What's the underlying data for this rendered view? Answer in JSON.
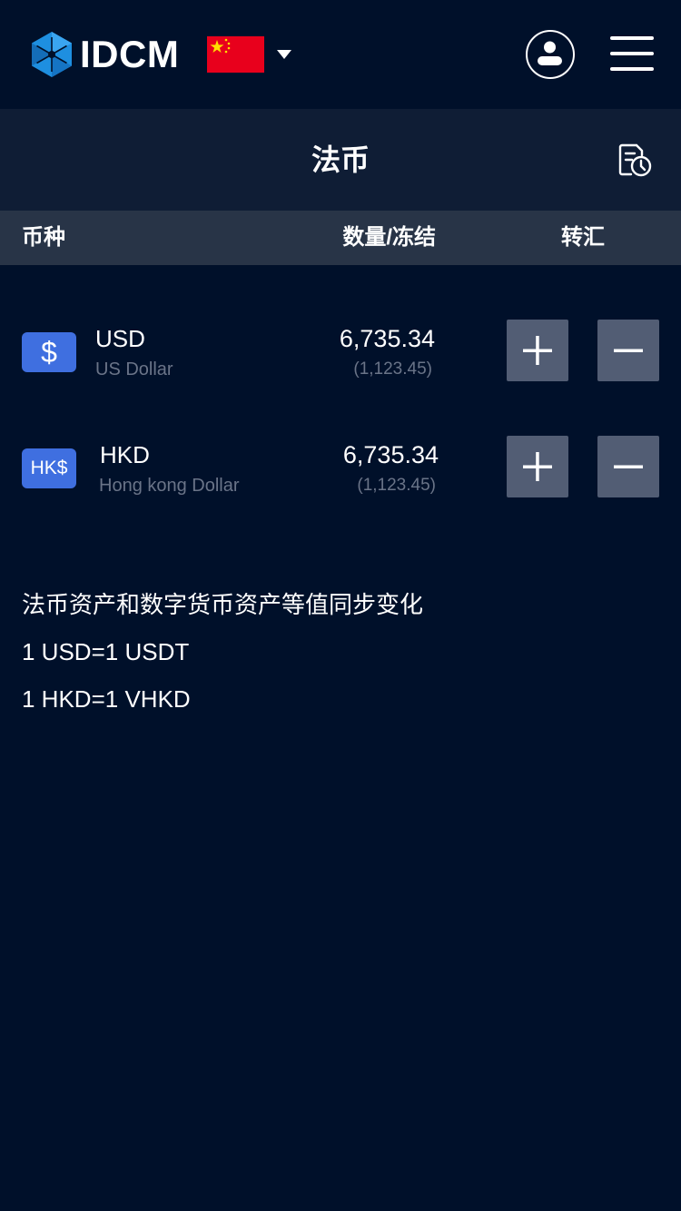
{
  "header": {
    "brand": "IDCM",
    "brand_color": "#1E8FE0",
    "flag": "china-flag",
    "icons": [
      "user-icon",
      "menu-icon",
      "dropdown-caret-icon",
      "history-icon"
    ]
  },
  "page": {
    "title": "法币"
  },
  "columns": {
    "currency": "币种",
    "quantity": "数量/冻结",
    "transfer": "转汇"
  },
  "assets": [
    {
      "icon_text": "$",
      "code": "USD",
      "name": "US Dollar",
      "amount": "6,735.34",
      "frozen": "(1,123.45)"
    },
    {
      "icon_text": "HK$",
      "code": "HKD",
      "name": "Hong kong Dollar",
      "amount": "6,735.34",
      "frozen": "(1,123.45)"
    }
  ],
  "notes": {
    "line1": "法币资产和数字货币资产等值同步变化",
    "line2": "1 USD=1 USDT",
    "line3": "1 HKD=1 VHKD"
  },
  "colors": {
    "background": "#00102A",
    "title_bar": "#0F1D35",
    "column_header": "#283447",
    "coin_icon": "#3F6FE0",
    "action_button": "#525D74",
    "muted_text": "#6A7488"
  }
}
